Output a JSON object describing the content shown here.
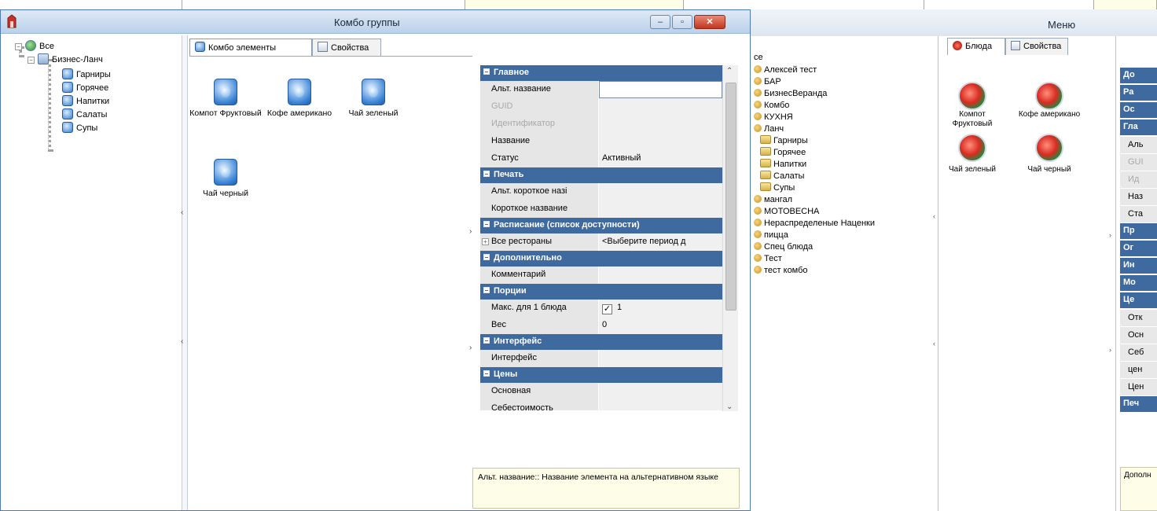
{
  "main_window": {
    "title": "Комбо группы",
    "tree": {
      "root": "Все",
      "group": "Бизнес-Ланч",
      "children": [
        "Гарниры",
        "Горячее",
        "Напитки",
        "Салаты",
        "Супы"
      ]
    },
    "tabs": [
      {
        "label": "Комбо элементы",
        "icon": "combo-icon",
        "active": true
      },
      {
        "label": "Свойства",
        "icon": "properties-icon",
        "active": false
      }
    ],
    "items": [
      {
        "label": "Компот Фруктовый"
      },
      {
        "label": "Кофе американо"
      },
      {
        "label": "Чай зеленый"
      },
      {
        "label": "Чай черный"
      }
    ],
    "property_grid": {
      "sections": {
        "main": "Главное",
        "print": "Печать",
        "schedule": "Расписание (список доступности)",
        "additional": "Дополнительно",
        "portions": "Порции",
        "interface": "Интерфейс",
        "prices": "Цены"
      },
      "rows": {
        "alt_name": "Альт. название",
        "alt_name_value": "",
        "guid": "GUID",
        "identifier": "Идентификатор",
        "name": "Название",
        "status": "Статус",
        "status_value": "Активный",
        "alt_short_name": "Альт. короткое назі",
        "short_name": "Короткое название",
        "all_restaurants": "Все рестораны",
        "all_restaurants_value": "<Выберите период д",
        "comment": "Комментарий",
        "max_per_dish": "Макс. для 1 блюда",
        "max_per_dish_value": "1",
        "weight": "Вес",
        "weight_value": "0",
        "interface": "Интерфейс",
        "main_price": "Основная",
        "cost": "Себестоимость"
      },
      "description": "Альт. название:: Название элемента на альтернативном языке"
    }
  },
  "menu_window": {
    "title": "Меню",
    "tree": {
      "root": "се",
      "items": [
        "Алексей тест",
        "БАР",
        "БизнесВеранда",
        "Комбо",
        "КУХНЯ",
        "Ланч"
      ],
      "lunch_children": [
        "Гарниры",
        "Горячее",
        "Напитки",
        "Салаты",
        "Супы"
      ],
      "items_after": [
        "мангал",
        "МОТОВЕСНА",
        "Нераспределеные Наценки",
        "пицца",
        "Спец блюда",
        "Тест",
        "тест комбо"
      ]
    },
    "tabs": [
      {
        "label": "Блюда",
        "active": true
      },
      {
        "label": "Свойства",
        "active": false
      }
    ],
    "dishes": [
      "Компот Фруктовый",
      "Кофе американо",
      "Чай зеленый",
      "Чай черный"
    ],
    "props_truncated": [
      "До",
      "Ра",
      "Ос",
      "Гла",
      "Аль",
      "GUI",
      "Ид",
      "Наз",
      "Ста",
      "Пр",
      "Ог",
      "Ин",
      "Мо",
      "Це",
      "Отк",
      "Осн",
      "Себ",
      "цен",
      "Цен",
      "Печ"
    ],
    "desc_truncated": "Дополн"
  }
}
